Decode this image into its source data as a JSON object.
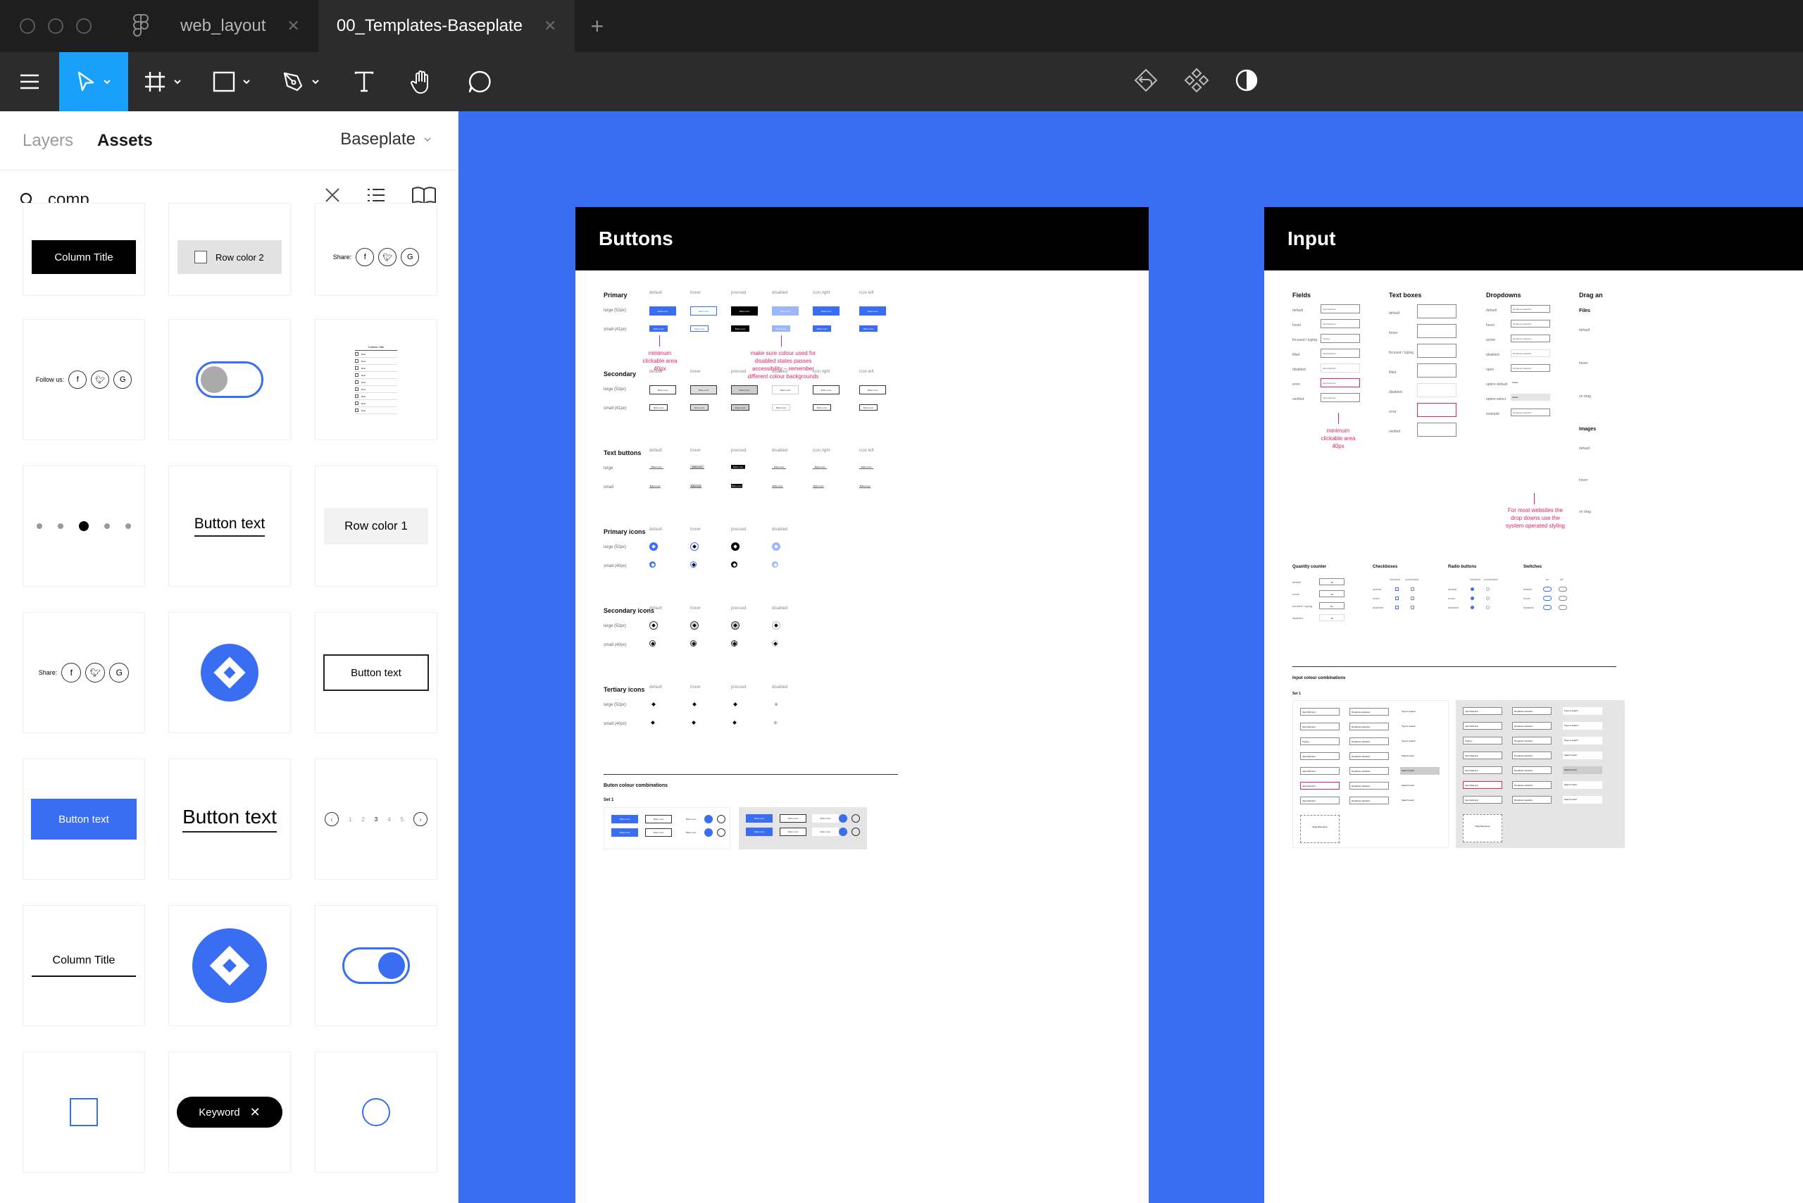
{
  "window": {
    "tabs": [
      {
        "label": "web_layout",
        "active": false
      },
      {
        "label": "00_Templates-Baseplate",
        "active": true
      }
    ]
  },
  "toolbar": {
    "tools": [
      "menu-icon",
      "move-tool-icon",
      "frame-tool-icon",
      "rectangle-tool-icon",
      "pen-tool-icon",
      "text-tool-icon",
      "hand-tool-icon",
      "comment-tool-icon"
    ],
    "center": [
      "component-link-icon",
      "component-icon",
      "contrast-icon"
    ]
  },
  "left_panel": {
    "tabs": {
      "layers": "Layers",
      "assets": "Assets"
    },
    "library": "Baseplate",
    "search_value": "comp",
    "assets": {
      "column_title": "Column Title",
      "row_color_2": "Row color 2",
      "share": "Share:",
      "follow_us": "Follow us:",
      "row_item": "Row",
      "button_text": "Button text",
      "row_color_1": "Row color 1",
      "keyword": "Keyword",
      "pager": [
        "1",
        "2",
        "3",
        "4",
        "5"
      ]
    }
  },
  "canvas": {
    "buttons_frame": {
      "title": "Buttons",
      "col_headers": [
        "default",
        "hover",
        "pressed",
        "disabled",
        "icon right",
        "icon left"
      ],
      "sections": [
        {
          "title": "Primary",
          "rows": [
            "large (52px)",
            "small (41px)"
          ]
        },
        {
          "title": "Secondary",
          "rows": [
            "large (52px)",
            "small (41px)"
          ]
        },
        {
          "title": "Text buttons",
          "rows": [
            "large",
            "small"
          ]
        },
        {
          "title": "Primary icons",
          "rows": [
            "large (52px)",
            "small (40px)"
          ]
        },
        {
          "title": "Secondary icons",
          "rows": [
            "large (52px)",
            "small (40px)"
          ]
        },
        {
          "title": "Tertiary icons",
          "rows": [
            "large (52px)",
            "small (40px)"
          ]
        }
      ],
      "btn_label": "Button text",
      "note_min_area": "minimum clickable area 40px",
      "note_disabled": "make sure colour used for disabled states passes accessibility – remember different colour backgrounds",
      "combos_title": "Buton colour combinations",
      "set_label": "Set 1"
    },
    "input_frame": {
      "title": "Input",
      "fields_title": "Fields",
      "text_boxes_title": "Text boxes",
      "dropdowns_title": "Dropdowns",
      "drag_title": "Drag an",
      "files_label": "Files",
      "images_label": "Images",
      "field_rows": [
        "default",
        "hover",
        "focused / typing",
        "filled",
        "disabled",
        "error",
        "verified"
      ],
      "field_values": [
        "Input field text",
        "Input field text",
        "Typing |",
        "Input field text",
        "Input field text",
        "Input field text",
        "Input field text"
      ],
      "textbox_rows": [
        "default",
        "hover",
        "focused / typing",
        "filled",
        "disabled",
        "error",
        "verified"
      ],
      "dropdown_rows": [
        "default",
        "hover",
        "active",
        "disabled",
        "open",
        "option default",
        "option select",
        "example"
      ],
      "dropdown_value": "Dropdown selection",
      "option_label": "Option",
      "drag_rows": [
        "default",
        "hover",
        "on drag"
      ],
      "image_rows": [
        "default",
        "hover",
        "on drag"
      ],
      "note_min_area": "minimum clickable area 40px",
      "note_dropdowns": "For most websites the drop downs use the system operated styling",
      "qty_title": "Quantity counter",
      "qty_rows": [
        "default",
        "hover",
        "focused / typing",
        "disabled"
      ],
      "qty_values": [
        "15",
        "16",
        "15 |",
        "15"
      ],
      "checkbox_title": "Checkboxes",
      "radio_title": "Radio buttons",
      "switch_title": "Switches",
      "checked": "checked",
      "unchecked": "unchecked",
      "on": "on",
      "off": "off",
      "state_rows": [
        "default",
        "hover",
        "disabled"
      ],
      "combos_title": "Input colour combinations",
      "set_label": "Set 1",
      "type_to_search": "Type to search",
      "search_result": "Search result",
      "drag_files_here": "Drag Files Here"
    }
  },
  "colors": {
    "accent": "#3a6ef2",
    "figma_blue": "#18a0fb",
    "error": "#e0245e"
  }
}
